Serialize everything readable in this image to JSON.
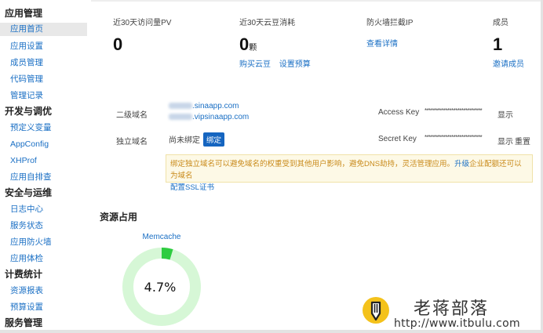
{
  "sidebar": {
    "groups": [
      {
        "title": "应用管理",
        "items": [
          "应用首页",
          "应用设置",
          "成员管理",
          "代码管理",
          "管理记录"
        ]
      },
      {
        "title": "开发与调优",
        "items": [
          "预定义变量",
          "AppConfig",
          "XHProf",
          "应用自排查"
        ]
      },
      {
        "title": "安全与运维",
        "items": [
          "日志中心",
          "服务状态",
          "应用防火墙",
          "应用体检"
        ]
      },
      {
        "title": "计费统计",
        "items": [
          "资源报表",
          "预算设置"
        ]
      },
      {
        "title": "服务管理",
        "items": []
      }
    ],
    "active_item": "应用首页"
  },
  "stats": {
    "pv": {
      "label": "近30天访问量PV",
      "value": "0"
    },
    "cloud": {
      "label": "近30天云豆消耗",
      "value": "0",
      "unit": "颗",
      "link1": "购买云豆",
      "link2": "设置预算"
    },
    "firewall": {
      "label": "防火墙拦截IP",
      "link": "查看详情"
    },
    "members": {
      "label": "成员",
      "value": "1",
      "link": "邀请成员"
    }
  },
  "domains": {
    "secondary_label": "二级域名",
    "secondary_1": ".sinaapp.com",
    "secondary_2": ".vipsinaapp.com",
    "independent_label": "独立域名",
    "independent_status": "尚未绑定",
    "bind_button": "绑定"
  },
  "keys": {
    "access_label": "Access Key",
    "access_value": "****************************",
    "access_show": "显示",
    "secret_label": "Secret Key",
    "secret_value": "****************************",
    "secret_show": "显示",
    "secret_reset": "重置"
  },
  "notice": {
    "text_part1": "绑定独立域名可以避免域名的权重受到其他用户影响，避免DNS劫持，灵活管理应用。",
    "link1": "升级",
    "text_part2": "企业配额还可以为域名",
    "link2": "配置SSL证书"
  },
  "resources": {
    "title": "资源占用",
    "memcache_label": "Memcache",
    "memcache_percent_text": "4.7%",
    "memcache_fraction": 0.047,
    "ring_color": "#d6f7d6",
    "ring_fill_color": "#2ecc40"
  },
  "watermark": {
    "title": "老蒋部落",
    "url": "http://www.itbulu.com"
  }
}
